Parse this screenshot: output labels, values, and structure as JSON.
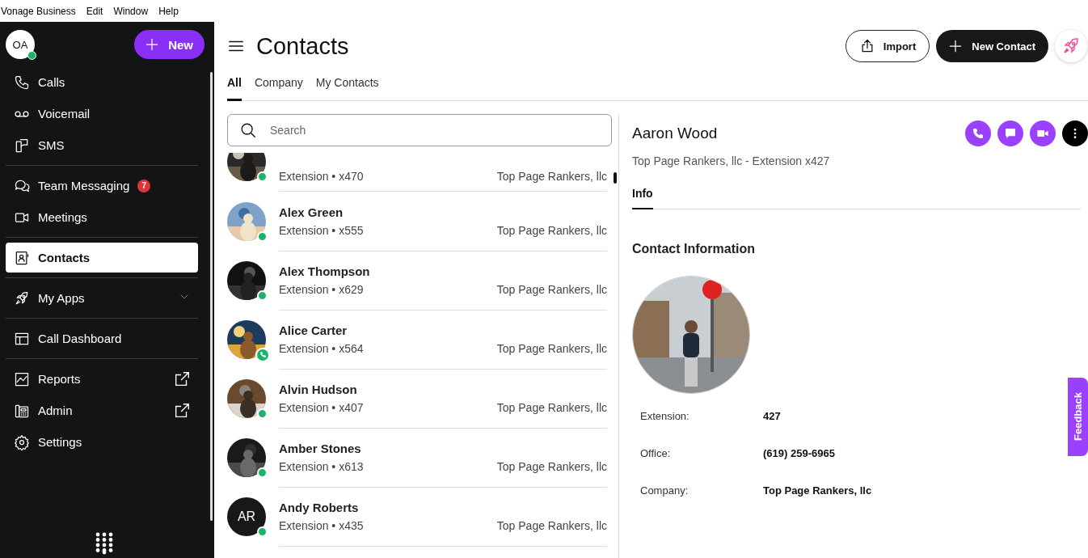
{
  "menu_bar": [
    "Vonage Business",
    "Edit",
    "Window",
    "Help"
  ],
  "sidebar": {
    "avatar": "OA",
    "avatar_online": true,
    "new_button": "New",
    "groups": [
      [
        {
          "label": "Calls",
          "selected": false
        },
        {
          "label": "Voicemail",
          "selected": false
        },
        {
          "label": "SMS",
          "selected": false
        }
      ],
      [
        {
          "label": "Team Messaging",
          "selected": false,
          "badge": "7"
        },
        {
          "label": "Meetings",
          "selected": false
        }
      ],
      [
        {
          "label": "Contacts",
          "selected": true
        }
      ],
      [
        {
          "label": "My Apps",
          "selected": false,
          "expanded": false
        }
      ],
      [
        {
          "label": "Call Dashboard",
          "selected": false
        }
      ],
      [
        {
          "label": "Reports",
          "selected": false,
          "external": true
        },
        {
          "label": "Admin",
          "selected": false,
          "external": true
        },
        {
          "label": "Settings",
          "selected": false
        }
      ]
    ]
  },
  "header": {
    "title": "Contacts",
    "import_button": "Import",
    "new_contact_button": "New Contact"
  },
  "tabs": [
    {
      "label": "All",
      "selected": true
    },
    {
      "label": "Company",
      "selected": false
    },
    {
      "label": "My Contacts",
      "selected": false
    }
  ],
  "search": {
    "placeholder": "Search"
  },
  "contacts": [
    {
      "detail": "Extension • x470",
      "company": "Top Page Rankers, llc",
      "on_call": false
    },
    {
      "name": "Alex Green",
      "detail": "Extension • x555",
      "company": "Top Page Rankers, llc",
      "on_call": false
    },
    {
      "name": "Alex Thompson",
      "detail": "Extension • x629",
      "company": "Top Page Rankers, llc",
      "on_call": false
    },
    {
      "name": "Alice Carter",
      "detail": "Extension • x564",
      "company": "Top Page Rankers, llc",
      "on_call": true
    },
    {
      "name": "Alvin Hudson",
      "detail": "Extension • x407",
      "company": "Top Page Rankers, llc",
      "on_call": false
    },
    {
      "name": "Amber Stones",
      "detail": "Extension • x613",
      "company": "Top Page Rankers, llc",
      "on_call": false
    },
    {
      "name": "Andy Roberts",
      "detail": "Extension • x435",
      "company": "Top Page Rankers, llc",
      "on_call": false,
      "avatar": {
        "kind": "initials",
        "text": "AR"
      }
    }
  ],
  "detail": {
    "name": "Aaron Wood",
    "subtitle": "Top Page Rankers, llc - Extension x427",
    "tabs": [
      {
        "label": "Info",
        "selected": true
      }
    ],
    "section_title": "Contact Information",
    "fields": [
      {
        "label": "Extension:",
        "value": "427"
      },
      {
        "label": "Office:",
        "value": "(619) 259-6965"
      },
      {
        "label": "Company:",
        "value": "Top Page Rankers, llc"
      }
    ]
  },
  "feedback": "Feedback"
}
